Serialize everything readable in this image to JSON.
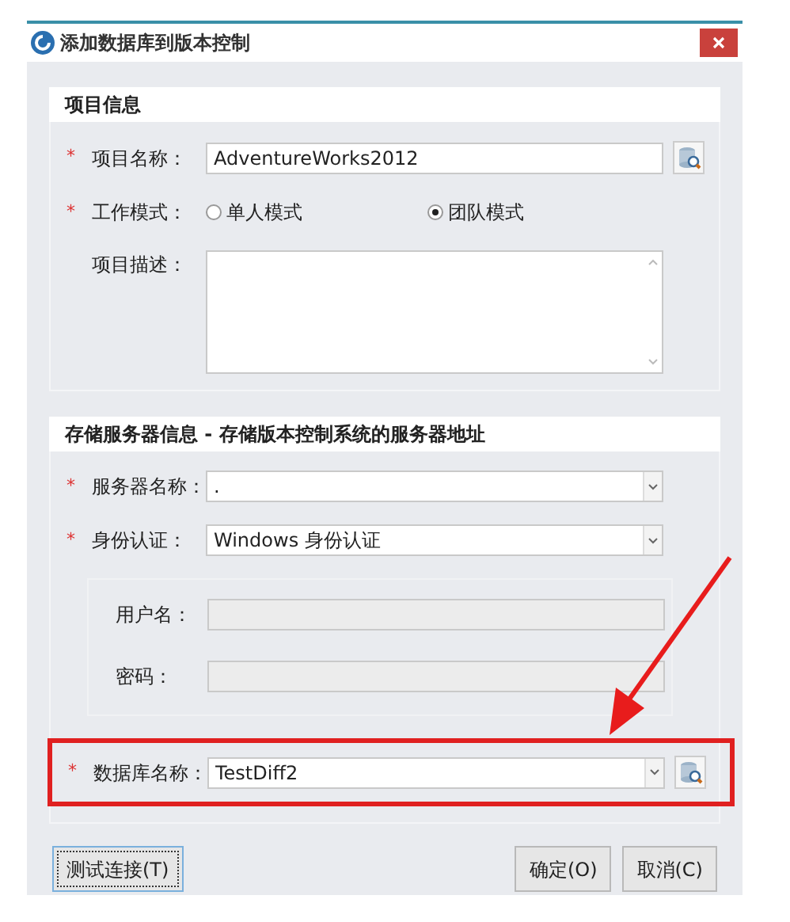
{
  "window": {
    "title": "添加数据库到版本控制"
  },
  "sections": [
    {
      "title": "项目信息",
      "fields": [
        {
          "kind": "text",
          "required_mark": "*",
          "label": "项目名称：",
          "value": "AdventureWorks2012",
          "browse": true
        },
        {
          "kind": "radio",
          "required_mark": "*",
          "label": "工作模式：",
          "options": [
            {
              "label": "单人模式",
              "selected": false
            },
            {
              "label": "团队模式",
              "selected": true
            }
          ]
        },
        {
          "kind": "textarea",
          "label": "项目描述："
        }
      ]
    },
    {
      "title": "存储服务器信息 - 存储版本控制系统的服务器地址",
      "fields": [
        {
          "kind": "combo",
          "required_mark": "*",
          "label": "服务器名称：",
          "value": "."
        },
        {
          "kind": "combo",
          "required_mark": "*",
          "label": "身份认证：",
          "value": "Windows 身份认证"
        },
        {
          "kind": "group",
          "fields": [
            {
              "kind": "text",
              "label": "用户名：",
              "disabled": true
            },
            {
              "kind": "text",
              "label": "密码：",
              "disabled": true
            }
          ]
        },
        {
          "kind": "combo",
          "required_mark": "*",
          "label": "数据库名称：",
          "value": "TestDiff2",
          "browse": true,
          "highlighted": true
        }
      ]
    }
  ],
  "buttons": [
    {
      "label": "测试连接(T)",
      "focused": true
    },
    {
      "label": "确定(O)",
      "focused": false
    },
    {
      "label": "取消(C)",
      "focused": false
    }
  ]
}
